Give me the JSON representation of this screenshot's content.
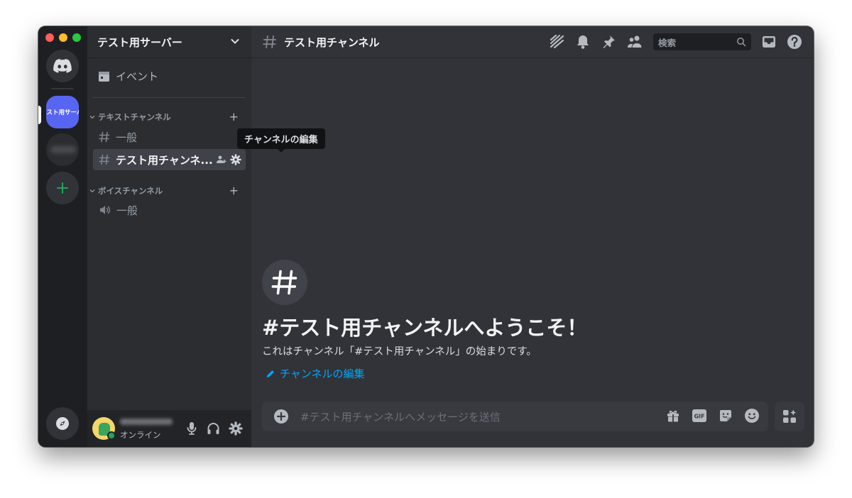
{
  "colors": {
    "accent": "#5865f2",
    "online": "#23a55a",
    "link": "#00a8fc"
  },
  "server": {
    "name": "テスト用サーバー",
    "rail_label": "テスト用サーバー"
  },
  "sidebar": {
    "event_label": "イベント",
    "categories": [
      {
        "label": "テキストチャンネル",
        "channels": [
          "一般",
          "テスト用チャンネ..."
        ]
      },
      {
        "label": "ボイスチャンネル",
        "channels": [
          "一般"
        ]
      }
    ],
    "tooltip": "チャンネルの編集"
  },
  "user": {
    "status": "オンライン"
  },
  "topbar": {
    "channel_name": "テスト用チャンネル",
    "search_placeholder": "検索"
  },
  "welcome": {
    "title": "#テスト用チャンネルへようこそ！",
    "description": "これはチャンネル「#テスト用チャンネル」の始まりです。",
    "edit_link": "チャンネルの編集"
  },
  "composer": {
    "placeholder": "#テスト用チャンネルへメッセージを送信"
  },
  "icons": [
    "discord-icon",
    "compass-icon",
    "plus-icon",
    "calendar-icon",
    "hash-icon",
    "speaker-icon",
    "invite-icon",
    "gear-icon",
    "mic-icon",
    "headphones-icon",
    "threads-icon",
    "bell-icon",
    "pin-icon",
    "members-icon",
    "search-icon",
    "inbox-icon",
    "help-icon",
    "gift-icon",
    "gif-icon",
    "sticker-icon",
    "emoji-icon",
    "apps-icon",
    "pencil-icon"
  ]
}
